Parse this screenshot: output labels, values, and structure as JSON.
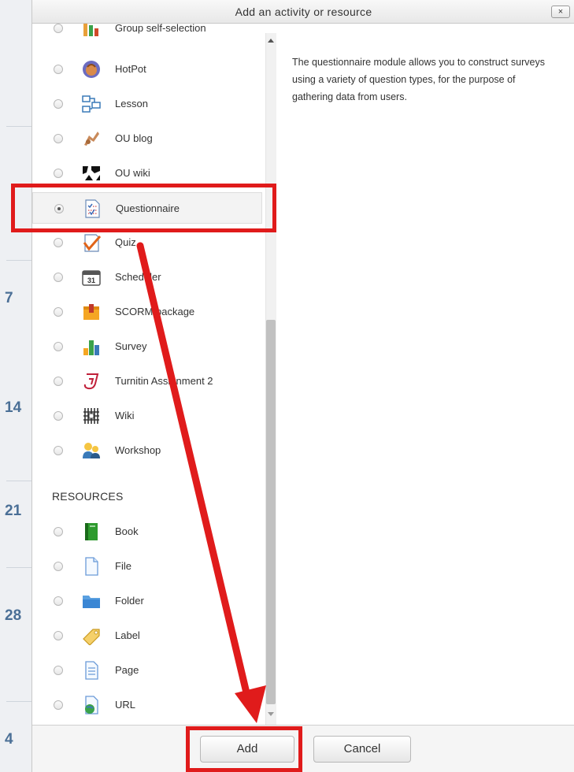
{
  "background": {
    "numbers": [
      "7",
      "14",
      "21",
      "28",
      "4"
    ]
  },
  "dialog": {
    "title": "Add an activity or resource",
    "close_label": "×",
    "activities": [
      {
        "label": "Group self-selection",
        "icon": "group-selection-icon"
      },
      {
        "label": "HotPot",
        "icon": "hotpot-icon"
      },
      {
        "label": "Lesson",
        "icon": "lesson-icon"
      },
      {
        "label": "OU blog",
        "icon": "ou-blog-icon"
      },
      {
        "label": "OU wiki",
        "icon": "ou-wiki-icon"
      },
      {
        "label": "Questionnaire",
        "icon": "questionnaire-icon",
        "selected": true
      },
      {
        "label": "Quiz",
        "icon": "quiz-icon"
      },
      {
        "label": "Scheduler",
        "icon": "calendar-icon"
      },
      {
        "label": "SCORM package",
        "icon": "scorm-package-icon"
      },
      {
        "label": "Survey",
        "icon": "bar-chart-icon"
      },
      {
        "label": "Turnitin Assignment 2",
        "icon": "turnitin-icon"
      },
      {
        "label": "Wiki",
        "icon": "wiki-icon"
      },
      {
        "label": "Workshop",
        "icon": "workshop-icon"
      }
    ],
    "resources_heading": "RESOURCES",
    "resources": [
      {
        "label": "Book",
        "icon": "book-icon"
      },
      {
        "label": "File",
        "icon": "file-icon"
      },
      {
        "label": "Folder",
        "icon": "folder-icon"
      },
      {
        "label": "Label",
        "icon": "tag-icon"
      },
      {
        "label": "Page",
        "icon": "page-icon"
      },
      {
        "label": "URL",
        "icon": "globe-page-icon"
      }
    ],
    "description": "The questionnaire module allows you to construct surveys using a variety of question types, for the purpose of gathering data from users.",
    "add_label": "Add",
    "cancel_label": "Cancel"
  },
  "colors": {
    "annotation_red": "#e01b1b",
    "accent_blue": "#4a6f96"
  }
}
